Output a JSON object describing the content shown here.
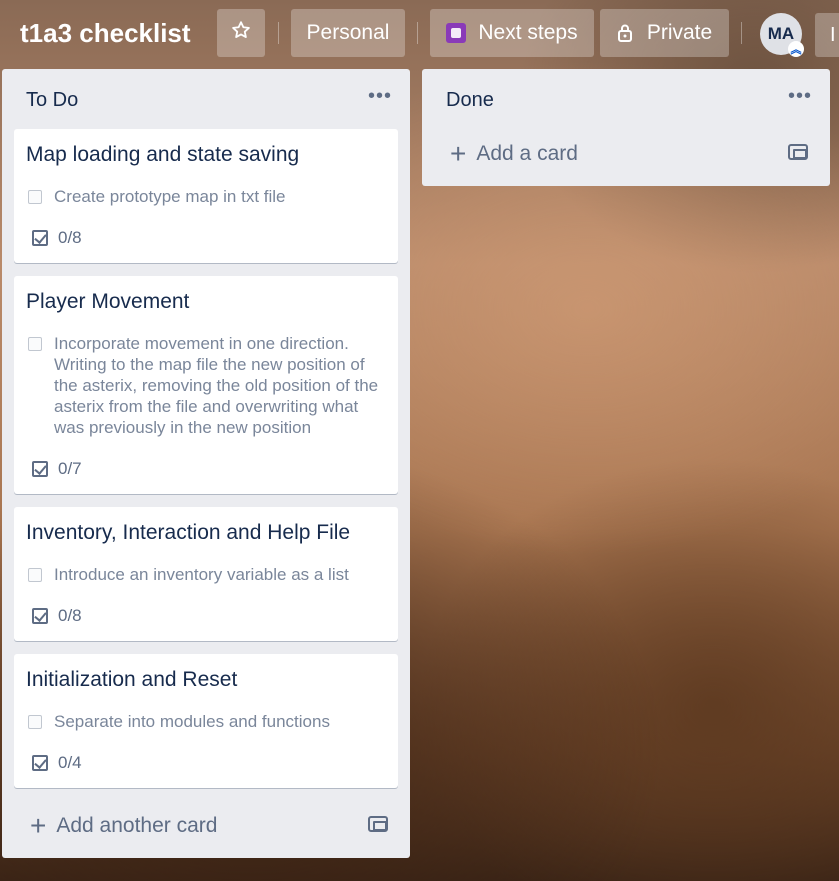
{
  "header": {
    "board_title": "t1a3 checklist",
    "star_icon": "star-icon",
    "workspace_button": "Personal",
    "next_steps_button": "Next steps",
    "visibility_button": "Private",
    "avatar_initials": "MA",
    "more_label": "I"
  },
  "lists": [
    {
      "title": "To Do",
      "menu": "•••",
      "cards": [
        {
          "title": "Map loading and state saving",
          "checklist_item": "Create prototype map in txt file",
          "badge": "0/8"
        },
        {
          "title": "Player Movement",
          "checklist_item": "Incorporate movement in one direction. Writing to the map file the new position of the asterix, removing the old position of the asterix from the file and overwriting what was previously in the new position",
          "badge": "0/7"
        },
        {
          "title": "Inventory, Interaction and Help File",
          "checklist_item": "Introduce an inventory variable as a list",
          "badge": "0/8"
        },
        {
          "title": "Initialization and Reset",
          "checklist_item": "Separate into modules and functions",
          "badge": "0/4"
        }
      ],
      "add_label": "Add another card"
    },
    {
      "title": "Done",
      "menu": "•••",
      "cards": [],
      "add_label": "Add a card"
    }
  ]
}
